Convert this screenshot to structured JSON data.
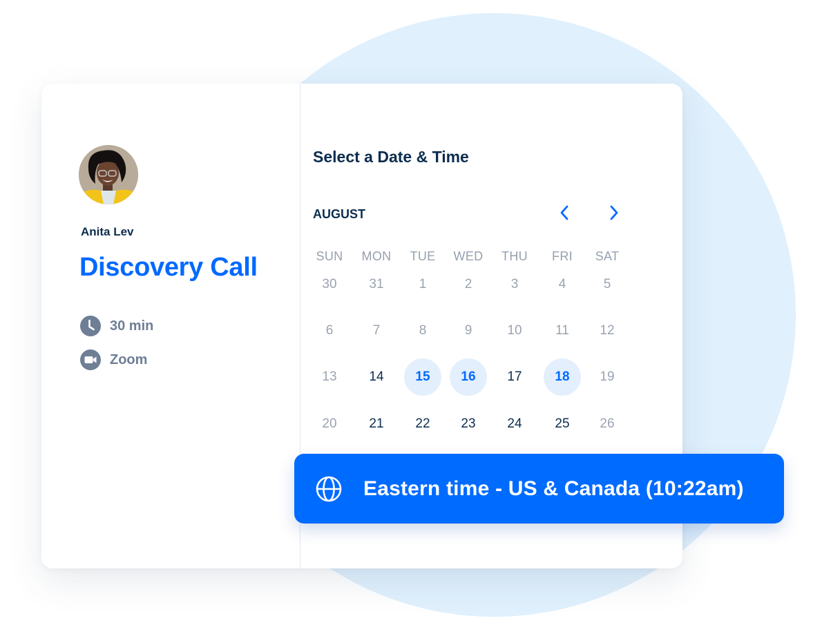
{
  "host": {
    "name": "Anita Lev",
    "avatar_icon": "person-avatar"
  },
  "event": {
    "title": "Discovery Call",
    "duration": {
      "icon": "clock-icon",
      "label": "30 min"
    },
    "location": {
      "icon": "video-camera-icon",
      "label": "Zoom"
    }
  },
  "scheduler": {
    "title": "Select a Date & Time",
    "month": "AUGUST",
    "prev_icon": "chevron-left-icon",
    "next_icon": "chevron-right-icon",
    "weekdays": [
      "SUN",
      "MON",
      "TUE",
      "WED",
      "THU",
      "FRI",
      "SAT"
    ],
    "weeks": [
      [
        {
          "d": "30",
          "s": "muted"
        },
        {
          "d": "31",
          "s": "muted"
        },
        {
          "d": "1",
          "s": "muted"
        },
        {
          "d": "2",
          "s": "muted"
        },
        {
          "d": "3",
          "s": "muted"
        },
        {
          "d": "4",
          "s": "muted"
        },
        {
          "d": "5",
          "s": "muted"
        }
      ],
      [
        {
          "d": "6",
          "s": "muted"
        },
        {
          "d": "7",
          "s": "muted"
        },
        {
          "d": "8",
          "s": "muted"
        },
        {
          "d": "9",
          "s": "muted"
        },
        {
          "d": "10",
          "s": "muted"
        },
        {
          "d": "11",
          "s": "muted"
        },
        {
          "d": "12",
          "s": "muted"
        }
      ],
      [
        {
          "d": "13",
          "s": "muted"
        },
        {
          "d": "14",
          "s": "active"
        },
        {
          "d": "15",
          "s": "available"
        },
        {
          "d": "16",
          "s": "available"
        },
        {
          "d": "17",
          "s": "active"
        },
        {
          "d": "18",
          "s": "available"
        },
        {
          "d": "19",
          "s": "muted"
        }
      ],
      [
        {
          "d": "20",
          "s": "muted"
        },
        {
          "d": "21",
          "s": "active"
        },
        {
          "d": "22",
          "s": "active"
        },
        {
          "d": "23",
          "s": "active"
        },
        {
          "d": "24",
          "s": "active"
        },
        {
          "d": "25",
          "s": "active"
        },
        {
          "d": "26",
          "s": "muted"
        }
      ]
    ]
  },
  "timezone": {
    "icon": "globe-icon",
    "label": "Eastern time - US & Canada (10:22am)"
  },
  "colors": {
    "brand_blue": "#006bff",
    "navy_text": "#0c2d4e",
    "muted_text": "#9aa3b0",
    "available_bg": "#e3effd",
    "bg_circle": "#e0f0fd"
  }
}
